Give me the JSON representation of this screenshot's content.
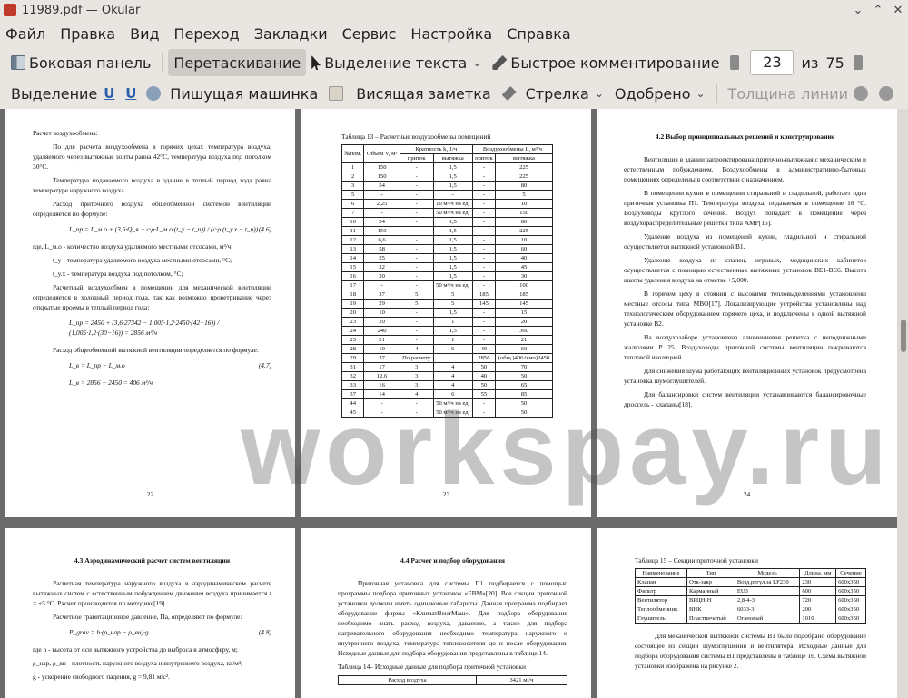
{
  "window": {
    "title": "11989.pdf  — Okular",
    "minimize": "⌄",
    "maximize": "⌃",
    "close": "✕"
  },
  "menu": [
    "Файл",
    "Правка",
    "Вид",
    "Переход",
    "Закладки",
    "Сервис",
    "Настройка",
    "Справка"
  ],
  "toolbar1": {
    "sidebar": "Боковая панель",
    "drag": "Перетаскивание",
    "text_select": "Выделение текста",
    "quick_comment": "Быстрое комментирование",
    "page_current": "23",
    "page_of": "из",
    "page_total": "75"
  },
  "toolbar2": {
    "highlight": "Выделение",
    "typewriter": "Пишущая машинка",
    "note": "Висящая заметка",
    "arrow": "Стрелка",
    "approved": "Одобрено",
    "line_width": "Толщина линии"
  },
  "watermark": "workspay.ru",
  "pages": {
    "p22": {
      "heading": "Расчет воздухообмена:",
      "para1": "По для расчета воздухообмена в горячих цехах температура воздуха, удаляемого через вытяжные зонты равна 42°С, температура воздуха под потолком 30°С.",
      "para2": "Температура подаваемого воздуха в здание в теплый период года равна температуре наружного воздуха.",
      "para3": "Расход приточного воздуха общеобменной системой вентиляции определяется по формуле:",
      "formula1": "L_пр = L_м.о + (3,6·Q_я − c·ρ·L_м.о·(t_у − t_п)) / (c·ρ·(t_у.х − t_п))",
      "formula1_no": "(4.6)",
      "where1": "где, L_м.о - количество воздуха удаляемого местными отсосами, м³/ч;",
      "where2": "t_у - температура удаляемого воздуха местными отсосами, °С;",
      "where3": "t_у.х - температура воздуха под потолком, °С;",
      "para4": "Расчетный воздухообмен в помещении для механической вентиляции определяется в холодный период года, так как возможно проветривание через открытые проемы в теплый период года:",
      "formula2": "L_пр = 2450 + (3,6·27342 − 1,005·1,2·2450·(42−16)) / (1,005·1,2·(30−16)) = 2856 м³/ч",
      "para5": "Расход общеобменной вытяжной вентиляции определяется по формуле:",
      "formula3": "L_в = L_пр − L_м.о",
      "formula3_no": "(4.7)",
      "formula4": "L_в = 2856 − 2450 = 406 м³/ч",
      "num": "22"
    },
    "p23": {
      "caption": "Таблица 13 – Расчетные воздухообмены помещений",
      "headers": [
        "№пом.",
        "Объем V, м³",
        "Кратность k, 1/ч",
        "Воздухообмены L, м³/ч",
        "приток",
        "вытяжка",
        "приток",
        "вытяжка"
      ],
      "rows": [
        [
          "1",
          "150",
          "-",
          "1,5",
          "-",
          "225"
        ],
        [
          "2",
          "150",
          "-",
          "1,5",
          "-",
          "225"
        ],
        [
          "3",
          "54",
          "-",
          "1,5",
          "-",
          "80"
        ],
        [
          "5",
          "-",
          "-",
          "-",
          "-",
          "5"
        ],
        [
          "6",
          "2,25",
          "-",
          "10 м³/ч на ед.",
          "-",
          "10"
        ],
        [
          "7",
          "-",
          "-",
          "50 м³/ч на ед.",
          "-",
          "150"
        ],
        [
          "10",
          "54",
          "-",
          "1,5",
          "-",
          "80"
        ],
        [
          "11",
          "150",
          "-",
          "1,5",
          "-",
          "225"
        ],
        [
          "12",
          "6,6",
          "-",
          "1,5",
          "-",
          "10"
        ],
        [
          "13",
          "58",
          "-",
          "1,5",
          "-",
          "60"
        ],
        [
          "14",
          "25",
          "-",
          "1,5",
          "-",
          "40"
        ],
        [
          "15",
          "32",
          "-",
          "1,5",
          "-",
          "45"
        ],
        [
          "16",
          "20",
          "-",
          "1,5",
          "-",
          "30"
        ],
        [
          "17",
          "-",
          "-",
          "50 м³/ч на ед.",
          "-",
          "100"
        ],
        [
          "18",
          "37",
          "5",
          "5",
          "185",
          "185"
        ],
        [
          "19",
          "29",
          "5",
          "5",
          "145",
          "145"
        ],
        [
          "20",
          "10",
          "-",
          "1,5",
          "-",
          "15"
        ],
        [
          "23",
          "20",
          "-",
          "1",
          "-",
          "20"
        ],
        [
          "24",
          "240",
          "-",
          "1,5",
          "-",
          "360"
        ],
        [
          "25",
          "21",
          "-",
          "1",
          "-",
          "21"
        ],
        [
          "28",
          "10",
          "4",
          "6",
          "40",
          "60"
        ],
        [
          "29",
          "37",
          "По расчету",
          "",
          "2856",
          "(общ.)406+(мо)2450"
        ],
        [
          "31",
          "17",
          "3",
          "4",
          "50",
          "70"
        ],
        [
          "32",
          "12,6",
          "3",
          "4",
          "40",
          "50"
        ],
        [
          "33",
          "16",
          "3",
          "4",
          "50",
          "65"
        ],
        [
          "37",
          "14",
          "4",
          "6",
          "55",
          "85"
        ],
        [
          "44",
          "-",
          "-",
          "50 м³/ч на ед.",
          "-",
          "50"
        ],
        [
          "45",
          "-",
          "-",
          "50 м³/ч на ед.",
          "-",
          "50"
        ]
      ],
      "num": "23"
    },
    "p24": {
      "heading": "4.2 Выбор принципиальных решений и конструирование",
      "paras": [
        "Вентиляция в здании запроектирована приточно-вытяжная с механическим и естественным побуждением. Воздухообмены в административно-бытовых помещениях определены в соответствии с назначением.",
        "В помещении кухни в помещении стиральной и гладильной, работает одна приточная установка П1. Температура воздуха, подаваемая в помещение 16 °С. Воздуховоды круглого сечения. Воздух попадает в помещение через воздухораспределительные решетки типа АМР[16].",
        "Удаление воздуха из помещений кухни, гладильной и стиральной осуществляется вытяжной установкой В1.",
        "Удаление воздуха из спален, игровых, медицинских кабинетов осуществляется с помощью естественных вытяжных установок ВЕ1-ВЕ6. Высота шахты удаления воздуха на отметке +5,000.",
        "В горячем цеху в стоянии с высокими тепловыделениями установлены местные отсосы типа МВО[17]. Локализирующие устройства установлены над технологическим оборудованием горячего цеха, и подключены к одной вытяжной установке В2.",
        "На воздухозаборе установлена алюминиевая решетка с неподвижными жалюзями Р 25. Воздуховоды приточной системы вентиляции покрываются тепловой изоляцией.",
        "Для снижения шума работающих вентиляционных установок предусмотрена установка шумоглушителей.",
        "Для балансировки систем вентиляции устанавливаются балансировочные дроссель - клапаны[18]."
      ],
      "num": "24"
    },
    "p25": {
      "heading": "4.3 Аэродинамический расчет систем вентиляции",
      "para1": "Расчетная температура наружного воздуха в аэродинамическом расчете вытяжных систем с естественным побуждением движения воздуха принимается t = +5 °С. Расчет производится по методике[19].",
      "para2": "Расчетное гравитационное давление, Па, определяют по формуле:",
      "formula": "P_grav = h·(ρ_нар − ρ_вн)·g",
      "formula_no": "(4.8)",
      "where1": "где h - высота от оси вытяжного устройства до выброса в атмосферу, м;",
      "where2": "ρ_нар, ρ_вн - плотность наружного воздуха и внутреннего воздуха, кг/м³;",
      "where3": "g - ускорение свободного падения, g = 9,81 м/с²."
    },
    "p26": {
      "heading": "4.4 Расчет и подбор оборудования",
      "para1": "Приточная установка для системы П1 подбирается с помощью программы подбора приточных установок «ЕВМ»[20]. Все секции приточной установки должны иметь одинаковые габариты. Данная программа подбирает оборудование фирмы «КлиматВентМаш». Для подбора оборудования необходимо знать расход воздуха, давление, а также для подбора нагревательного оборудования необходимо температура наружного и внутреннего воздуха, температура теплоносителя до и после оборудования. Исходные данные для подбора оборудования представлены в таблице 14.",
      "caption": "Таблица 14– Исходные данные для подбора приточной установки",
      "row1": [
        "Расход воздуха",
        "3421 м³/ч"
      ]
    },
    "p27": {
      "caption": "Таблица 15 – Секции приточной установки",
      "headers": [
        "Наименование",
        "Тип",
        "Модель",
        "Длина, мм",
        "Сечение"
      ],
      "rows": [
        [
          "Клапан",
          "Отк-закр",
          "Возд.регул.за LF230",
          "230",
          "600х350"
        ],
        [
          "Фильтр",
          "Карманный",
          "EU3",
          "600",
          "600х350"
        ],
        [
          "Вентилятор",
          "ВРЦН-Н",
          "2,8-4-3",
          "720",
          "600х350"
        ],
        [
          "Теплообменник",
          "ВНК",
          "6033-3",
          "200",
          "600х350"
        ],
        [
          "Глушитель",
          "Пластинчатый",
          "Огановый",
          "1010",
          "600х350"
        ]
      ],
      "para1": "Для механической вытяжной системы В1 было подобрано оборудование состоящее из секции шумоглушения и вентилятора. Исходные данные для подбора оборудования системы В1 представлены в таблице 16. Схема вытяжной установки изображена на рисунке 2."
    }
  }
}
